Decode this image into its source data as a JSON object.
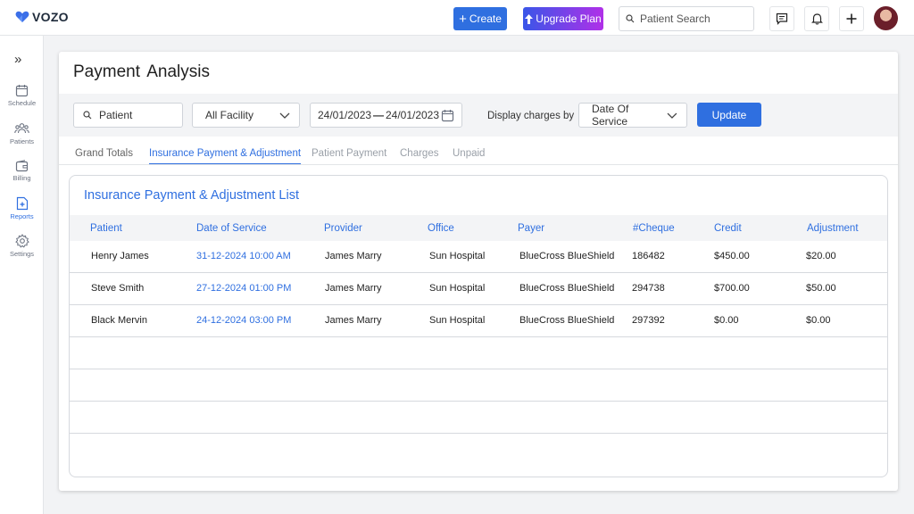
{
  "app": {
    "logo_text": "VOZO",
    "create_label": "Create",
    "upgrade_label": "Upgrade Plan",
    "search_placeholder": "Patient Search"
  },
  "sidebar": {
    "items": [
      {
        "label": "Schedule",
        "icon": "calendar-icon"
      },
      {
        "label": "Patients",
        "icon": "patients-icon"
      },
      {
        "label": "Billing",
        "icon": "wallet-icon"
      },
      {
        "label": "Reports",
        "icon": "report-icon",
        "active": true
      },
      {
        "label": "Settings",
        "icon": "gear-icon"
      }
    ]
  },
  "page": {
    "title": "Payment  Analysis"
  },
  "filters": {
    "patient_placeholder": "Patient",
    "facility": "All Facility",
    "date_from": "24/01/2023",
    "date_sep": "—",
    "date_to": "24/01/2023",
    "display_label": "Display charges by",
    "display_value": "Date Of Service",
    "update_label": "Update"
  },
  "tabs": [
    {
      "label": "Grand Totals"
    },
    {
      "label": "Insurance Payment & Adjustment",
      "active": true
    },
    {
      "label": "Patient Payment"
    },
    {
      "label": "Charges"
    },
    {
      "label": "Unpaid"
    }
  ],
  "list": {
    "title": "Insurance Payment & Adjustment List",
    "columns": [
      "Patient",
      "Date of Service",
      "Provider",
      "Office",
      "Payer",
      "#Cheque",
      "Credit",
      "Adjustment"
    ],
    "rows": [
      [
        "Henry James",
        "31-12-2024 10:00 AM",
        "James Marry",
        "Sun Hospital",
        "BlueCross BlueShield",
        "186482",
        "$450.00",
        "$20.00"
      ],
      [
        "Steve Smith",
        "27-12-2024 01:00 PM",
        "James Marry",
        "Sun Hospital",
        "BlueCross BlueShield",
        "294738",
        "$700.00",
        "$50.00"
      ],
      [
        "Black Mervin",
        "24-12-2024 03:00 PM",
        "James Marry",
        "Sun Hospital",
        "BlueCross BlueShield",
        "297392",
        "$0.00",
        "$0.00"
      ]
    ]
  },
  "colors": {
    "accent": "#2f6fe0",
    "upgrade_gradient_start": "#3a56e8",
    "upgrade_gradient_end": "#b030e8"
  }
}
